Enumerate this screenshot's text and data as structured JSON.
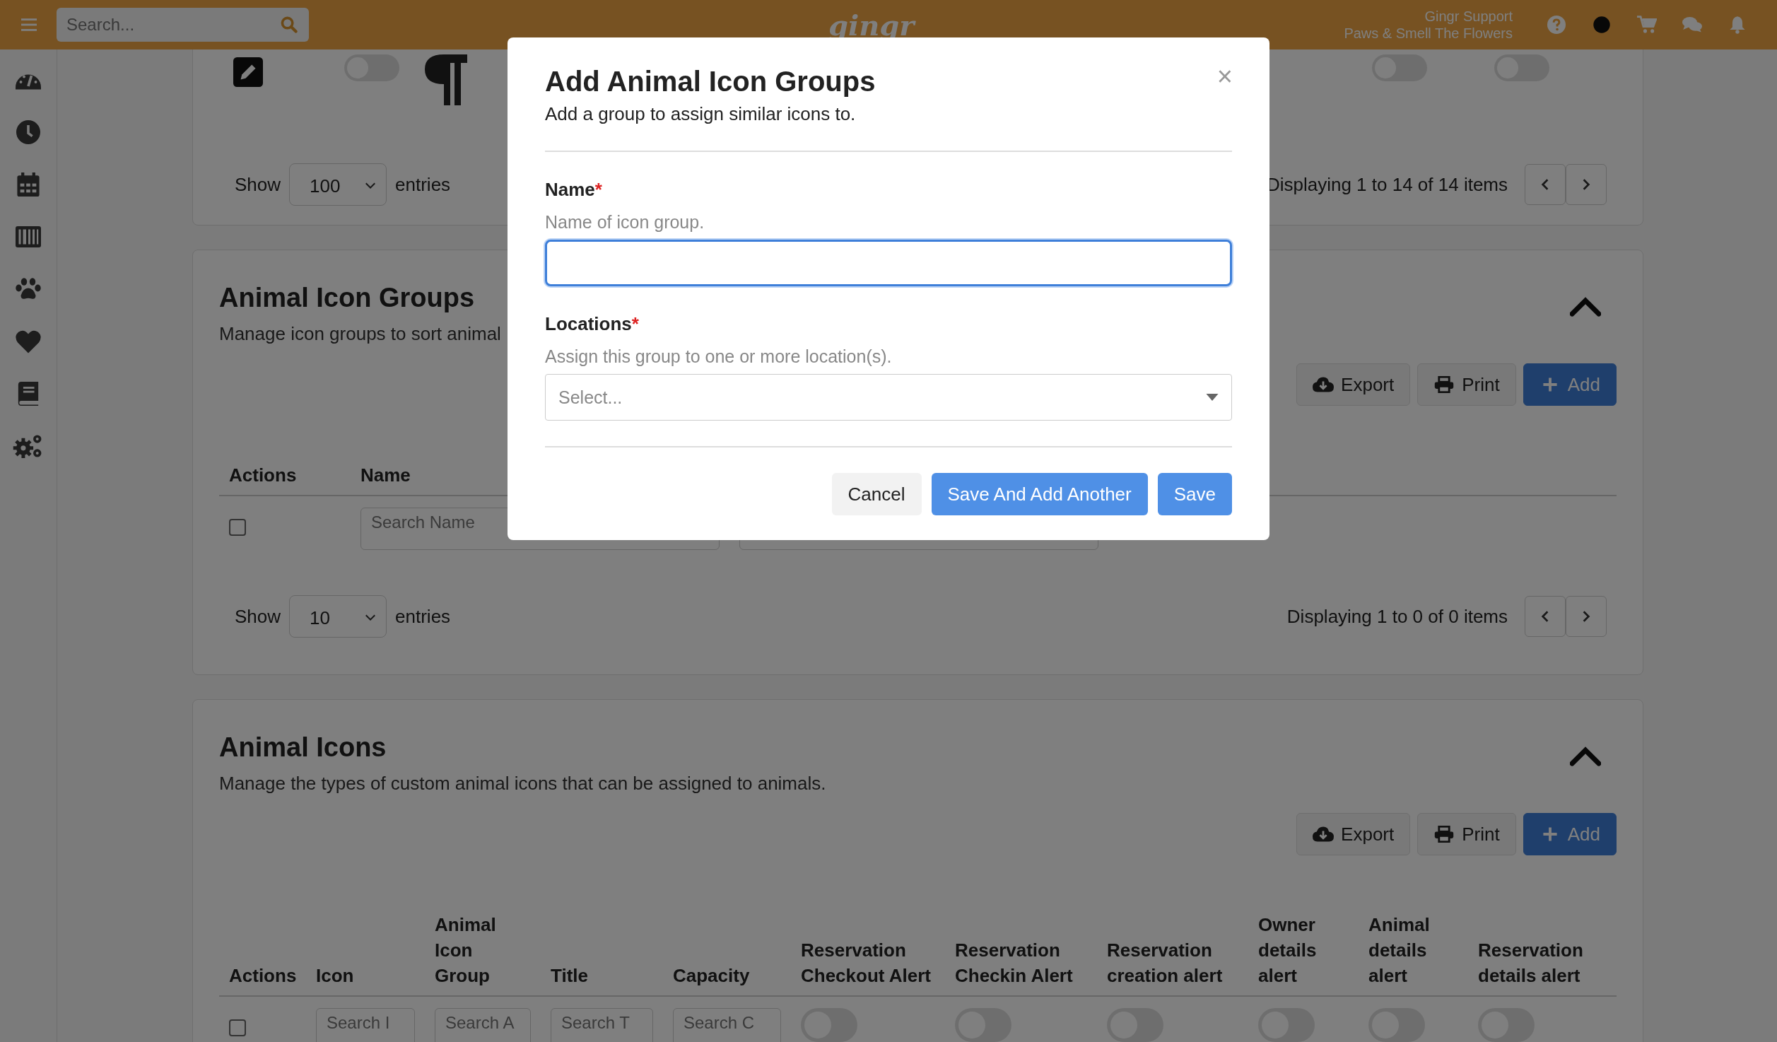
{
  "topbar": {
    "search_placeholder": "Search...",
    "logo": "gingr",
    "user_name": "Gingr Support",
    "location_name": "Paws & Smell The Flowers"
  },
  "sidebar": {
    "items": [
      {
        "kind": "gauge"
      },
      {
        "kind": "clock"
      },
      {
        "kind": "calendar"
      },
      {
        "kind": "barcode"
      },
      {
        "kind": "paw"
      },
      {
        "kind": "heart"
      },
      {
        "kind": "book"
      },
      {
        "kind": "gears"
      }
    ]
  },
  "top_card": {
    "toggles_left": [
      {
        "on": false
      }
    ],
    "toggles_right": [
      {
        "on": false
      },
      {
        "on": false
      }
    ],
    "show_label": "Show",
    "page_size": "100",
    "entries_label": "entries",
    "summary": "Displaying 1 to 14 of 14 items"
  },
  "sections": [
    {
      "title": "Animal Icon Groups",
      "description": "Manage icon groups to sort animal",
      "buttons": [
        {
          "kind": "export",
          "label": "Export"
        },
        {
          "kind": "print",
          "label": "Print"
        },
        {
          "kind": "add",
          "label": "Add"
        }
      ],
      "columns": [
        "Actions",
        "Name"
      ],
      "filters": [
        {
          "kind": "checkbox",
          "checked": false
        },
        {
          "kind": "search",
          "placeholder": "Search Name"
        },
        {
          "kind": "search"
        }
      ],
      "footer": {
        "show_label": "Show",
        "page_size": "10",
        "entries_label": "entries",
        "summary": "Displaying 1 to 0 of 0 items"
      }
    },
    {
      "title": "Animal Icons",
      "description": "Manage the types of custom animal icons that can be assigned to animals.",
      "buttons": [
        {
          "kind": "export",
          "label": "Export"
        },
        {
          "kind": "print",
          "label": "Print"
        },
        {
          "kind": "add",
          "label": "Add"
        }
      ],
      "columns": [
        "Actions",
        "Icon",
        "Animal Icon Group",
        "Title",
        "Capacity",
        "Reservation Checkout Alert",
        "Reservation Checkin Alert",
        "Reservation creation alert",
        "Owner details alert",
        "Animal details alert",
        "Reservation details alert"
      ],
      "filters": [
        {
          "kind": "checkbox",
          "checked": false
        },
        {
          "kind": "search",
          "placeholder": "Search I"
        },
        {
          "kind": "search",
          "placeholder": "Search A"
        },
        {
          "kind": "search",
          "placeholder": "Search T"
        },
        {
          "kind": "search",
          "placeholder": "Search C"
        },
        {
          "kind": "toggle",
          "on": false
        },
        {
          "kind": "toggle",
          "on": false
        },
        {
          "kind": "toggle",
          "on": false
        },
        {
          "kind": "toggle",
          "on": false
        },
        {
          "kind": "toggle",
          "on": false
        },
        {
          "kind": "toggle",
          "on": false
        }
      ]
    }
  ],
  "dialog": {
    "title": "Add Animal Icon Groups",
    "subtitle": "Add a group to assign similar icons to.",
    "close": "×",
    "fields": [
      {
        "kind": "text",
        "label": "Name",
        "required_mark": "*",
        "hint": "Name of icon group.",
        "focused": true
      },
      {
        "kind": "select",
        "label": "Locations",
        "required_mark": "*",
        "hint": "Assign this group to one or more location(s).",
        "placeholder": "Select..."
      }
    ],
    "buttons": [
      {
        "kind": "secondary",
        "label": "Cancel"
      },
      {
        "kind": "primary",
        "label": "Save And Add Another"
      },
      {
        "kind": "primary",
        "label": "Save"
      }
    ]
  }
}
